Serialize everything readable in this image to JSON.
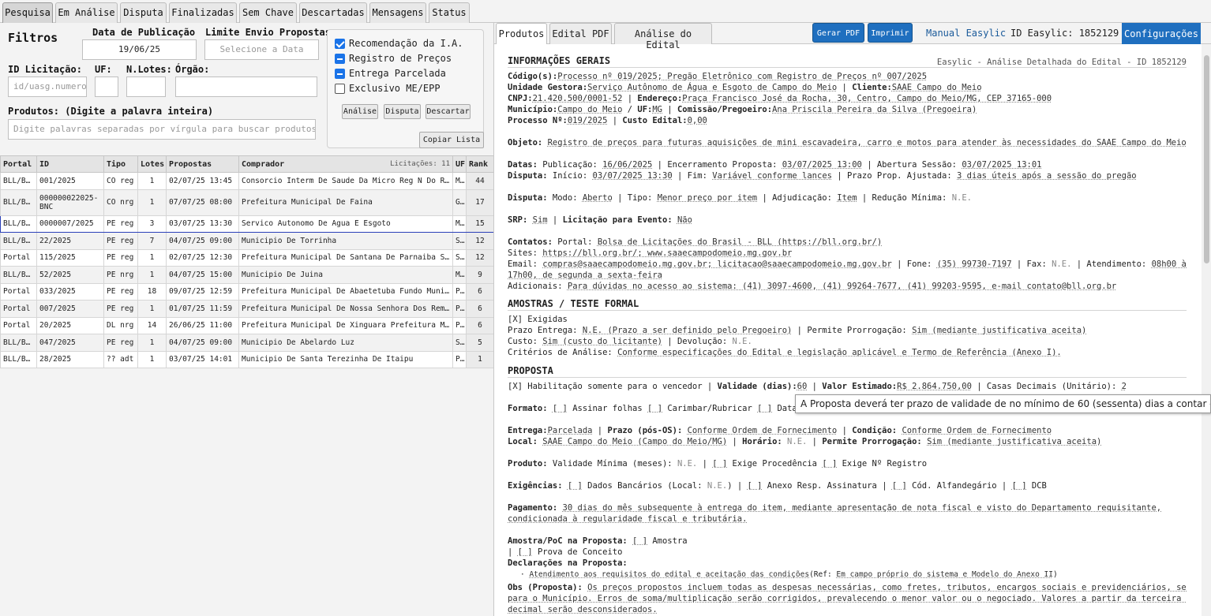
{
  "top_tabs": [
    "Pesquisa",
    "Em Análise",
    "Disputa",
    "Finalizadas",
    "Sem Chave",
    "Descartadas",
    "Mensagens",
    "Status"
  ],
  "filters": {
    "title": "Filtros",
    "pub_label": "Data de Publicação",
    "pub_value": "19/06/25",
    "limit_label": "Limite Envio Propostas",
    "limit_placeholder": "Selecione a Data",
    "id_label": "ID Licitação:",
    "id_placeholder": "id/uasg.numero",
    "uf_label": "UF:",
    "lotes_label": "N.Lotes:",
    "orgao_label": "Órgão:",
    "prod_label": "Produtos: (Digite a palavra inteira)",
    "prod_placeholder": "Digite palavras separadas por vírgula para buscar produtos",
    "checks": [
      "Recomendação da I.A.",
      "Registro de Preços",
      "Entrega Parcelada",
      "Exclusivo ME/EPP"
    ],
    "btn_analise": "Análise",
    "btn_disputa": "Disputa",
    "btn_descartar": "Descartar",
    "btn_copiar": "Copiar Lista"
  },
  "table": {
    "headers": [
      "Portal",
      "ID",
      "Tipo",
      "Lotes",
      "Propostas",
      "Comprador",
      "UF",
      "Rank"
    ],
    "count_label": "Licitações: 11",
    "rows": [
      [
        "BLL/BNC",
        "001/2025",
        "CO reg",
        "1",
        "02/07/25 13:45",
        "Consorcio Interm De Saude Da Micro Reg N Do Rio Doce",
        "MG",
        "44"
      ],
      [
        "BLL/BNC",
        "000000022025-BNC",
        "CO nrg",
        "1",
        "07/07/25 08:00",
        "Prefeitura Municipal De Faina",
        "GO",
        "17"
      ],
      [
        "BLL/BNC",
        "0000007/2025",
        "PE reg",
        "3",
        "03/07/25 13:30",
        "Servico Autonomo De Agua E Esgoto",
        "MG",
        "15"
      ],
      [
        "BLL/BNC",
        "22/2025",
        "PE reg",
        "7",
        "04/07/25 09:00",
        "Municipio De Torrinha",
        "SP",
        "12"
      ],
      [
        "Portal",
        "115/2025",
        "PE reg",
        "1",
        "02/07/25 12:30",
        "Prefeitura Municipal De Santana De Parnaiba Sec",
        "SP",
        "12"
      ],
      [
        "BLL/BNC",
        "52/2025",
        "PE nrg",
        "1",
        "04/07/25 15:00",
        "Municipio De Juina",
        "MT",
        "9"
      ],
      [
        "Portal",
        "033/2025",
        "PE reg",
        "18",
        "09/07/25 12:59",
        "Prefeitura Municipal De Abaetetuba Fundo Municipal",
        "PA",
        "6"
      ],
      [
        "Portal",
        "007/2025",
        "PE reg",
        "1",
        "01/07/25 11:59",
        "Prefeitura Municipal De Nossa Senhora Dos Remedios",
        "PI",
        "6"
      ],
      [
        "Portal",
        "20/2025",
        "DL nrg",
        "14",
        "26/06/25 11:00",
        "Prefeitura Municipal De Xinguara Prefeitura Municipal",
        "PA",
        "6"
      ],
      [
        "BLL/BNC",
        "047/2025",
        "PE reg",
        "1",
        "04/07/25 09:00",
        "Municipio De Abelardo Luz",
        "SC",
        "5"
      ],
      [
        "BLL/BNC",
        "28/2025",
        "?? adt",
        "1",
        "03/07/25 14:01",
        "Municipio De Santa Terezinha De Itaipu",
        "PR",
        "1"
      ]
    ]
  },
  "right": {
    "tabs": [
      "Produtos",
      "Edital PDF",
      "Análise do Edital"
    ],
    "gerar_pdf": "Gerar PDF",
    "imprimir": "Imprimir",
    "manual": "Manual Easylic",
    "id_easylic": "ID Easylic: 1852129",
    "config": "Configurações"
  },
  "doc": {
    "h1": "INFORMAÇÕES GERAIS",
    "h1_sub": "Easylic - Análise Detalhada do Edital - ID 1852129",
    "codigo_k": "Código(s):",
    "codigo_v": "Processo nº 019/2025; Pregão Eletrônico com Registro de Preços nº 007/2025",
    "ug_k": "Unidade Gestora:",
    "ug_v": "Serviço Autônomo de Água e Esgoto de Campo do Meio",
    "cliente_k": "Cliente:",
    "cliente_v": "SAAE Campo do Meio",
    "cnpj_k": "CNPJ:",
    "cnpj_v": "21.420.500/0001-52",
    "end_k": "Endereço:",
    "end_v": "Praça Francisco José da Rocha, 30, Centro, Campo do Meio/MG, CEP 37165-000",
    "mun_k": "Município:",
    "mun_v": "Campo do Meio",
    "uf_k": "UF:",
    "uf_v": "MG",
    "com_k": "Comissão/Pregoeiro:",
    "com_v": "Ana Priscila Pereira da Silva (Pregoeira)",
    "proc_k": "Processo Nº:",
    "proc_v": "019/2025",
    "custo_k": "Custo Edital:",
    "custo_v": "0,00",
    "obj_k": "Objeto:",
    "obj_v": "Registro de preços para futuras aquisições de mini escavadeira, carro e motos para atender às necessidades do SAAE Campo do Meio",
    "datas_k": "Datas:",
    "pub_t": "Publicação:",
    "pub_v": "16/06/2025",
    "enc_t": "Encerramento Proposta:",
    "enc_v": "03/07/2025 13:00",
    "abe_t": "Abertura Sessão:",
    "abe_v": "03/07/2025 13:01",
    "disp_k": "Disputa:",
    "ini_t": "Início:",
    "ini_v": "03/07/2025 13:30",
    "fim_t": "Fim:",
    "fim_v": "Variável conforme lances",
    "prazo_t": "Prazo Prop. Ajustada:",
    "prazo_v": "3 dias úteis após a sessão do pregão",
    "modo_t": "Modo:",
    "modo_v": "Aberto",
    "tipo_t": "Tipo:",
    "tipo_v": "Menor preço por item",
    "adj_t": "Adjudicação:",
    "adj_v": "Item",
    "red_t": "Redução Mínima:",
    "red_v": "N.E.",
    "srp_k": "SRP:",
    "srp_v": "Sim",
    "lic_k": "Licitação para Evento:",
    "lic_v": "Não",
    "cont_k": "Contatos:",
    "portal_t": "Portal:",
    "portal_v": "Bolsa de Licitações do Brasil - BLL (https://bll.org.br/)",
    "sites_t": "Sites:",
    "sites_v": "https://bll.org.br/; www.saaecampodomeio.mg.gov.br",
    "email_t": "Email:",
    "email_v": "compras@saaecampodomeio.mg.gov.br; licitacao@saaecampodomeio.mg.gov.br",
    "fone_t": "Fone:",
    "fone_v": "(35) 99730-7197",
    "fax_t": "Fax:",
    "fax_v": "N.E.",
    "atend_t": "Atendimento:",
    "atend_v1": "08h00 às",
    "atend_v2": "17h00, de segunda a sexta-feira",
    "adic_t": "Adicionais:",
    "adic_v": "Para dúvidas no acesso ao sistema: (41) 3097-4600, (41) 99264-7677, (41) 99203-9595, e-mail contato@bll.org.br",
    "h2": "AMOSTRAS / TESTE FORMAL",
    "exig": "[X] Exigidas",
    "pe_t": "Prazo Entrega:",
    "pe_v": "N.E. (Prazo a ser definido pelo Pregoeiro)",
    "pp_t": "Permite Prorrogação:",
    "pp_v": "Sim (mediante justificativa aceita)",
    "custo2_t": "Custo:",
    "custo2_v": "Sim (custo do licitante)",
    "dev_t": "Devolução:",
    "dev_v": "N.E.",
    "crit_t": "Critérios de Análise:",
    "crit_v": "Conforme especificações do Edital e legislação aplicável e Termo de Referência (Anexo I).",
    "h3": "PROPOSTA",
    "hab": "[X] Habilitação somente para o vencedor",
    "val_k": "Validade (dias):",
    "val_v": "60",
    "ve_k": "Valor Estimado:",
    "ve_v": "R$ 2.864.750,00",
    "cd_t": "Casas Decimais (Unitário):",
    "cd_v": "2",
    "form_k": "Formato:",
    "f1": "[ ]",
    "f1t": "Assinar folhas",
    "f2": "[ ]",
    "f2t": "Carimbar/Rubricar",
    "f3": "[ ]",
    "f3t": "Datar",
    "ent_k": "Entrega:",
    "ent_v": "Parcelada",
    "pos_k": "Prazo (pós-OS):",
    "pos_v": "Conforme Ordem de Fornecimento",
    "cond_k": "Condição:",
    "cond_v": "Conforme Ordem de Fornecimento",
    "loc_k": "Local:",
    "loc_v": "SAAE Campo do Meio (Campo do Meio/MG)",
    "hor_k": "Horário:",
    "hor_v": "N.E.",
    "pp2_k": "Permite Prorrogação:",
    "pp2_v": "Sim (mediante justificativa aceita)",
    "prod_k": "Produto:",
    "prod_t": "Validade Mínima (meses):",
    "prod_v": "N.E.",
    "proc2": "[ ]",
    "proc2t": "Exige Procedência",
    "reg": "[ ]",
    "regt": "Exige Nº Registro",
    "exg_k": "Exigências:",
    "e1": "[ ]",
    "e1t": "Dados Bancários (Local:",
    "e1v": "N.E.",
    "e1c": ")",
    "e2": "[ ]",
    "e2t": "Anexo Resp. Assinatura",
    "e3": "[ ]",
    "e3t": "Cód. Alfandegário",
    "e4": "[ ]",
    "e4t": "DCB",
    "pag_k": "Pagamento:",
    "pag_v1": "30 dias do mês subsequente à entrega do item, mediante apresentação de nota fiscal e visto do Departamento requisitante,",
    "pag_v2": "condicionada à regularidade fiscal e tributária.",
    "am_k": "Amostra/PoC na Proposta:",
    "am1": "[ ]",
    "am1t": "Amostra",
    "am2": "[ ]",
    "am2t": "Prova de Conceito",
    "dec_k": "Declarações na Proposta:",
    "dec_item": "Atendimento aos requisitos do edital e aceitação das condições",
    "dec_ref": "(Ref:",
    "dec_ref_v": "Em campo próprio do sistema e Modelo do Anexo II",
    "dec_ref_c": ")",
    "obs_k": "Obs (Proposta):",
    "obs_v1": "Os preços propostos incluem todas as despesas necessárias, como fretes, tributos, encargos sociais e previdenciários, sem ônus",
    "obs_v2": "para o Município. Erros de soma/multiplicação serão corrigidos, prevalecendo o menor valor ou o negociado. Valores a partir da terceira casa",
    "obs_v3": "decimal serão desconsiderados."
  },
  "tooltip": "A Proposta deverá ter prazo de validade de no mínimo de 60 (sessenta) dias a contar da data de sua apresentação"
}
